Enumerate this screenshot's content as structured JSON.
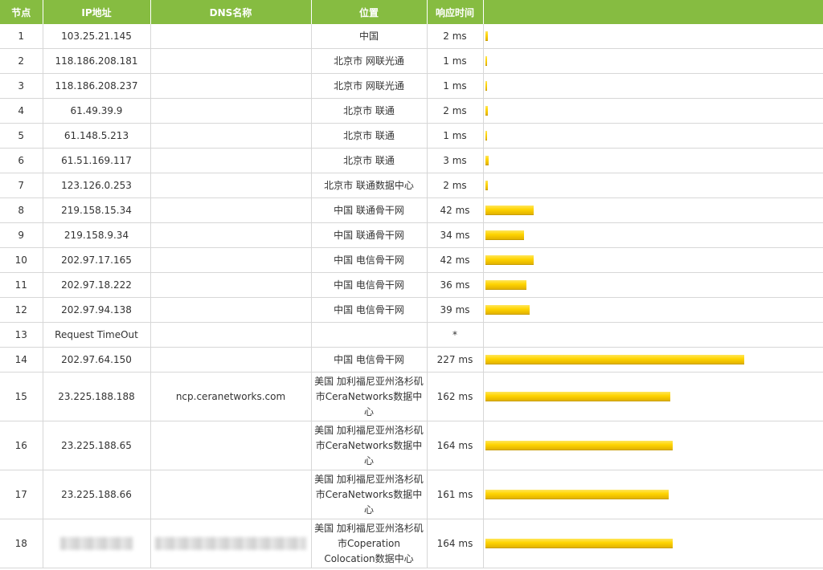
{
  "headers": [
    "节点",
    "IP地址",
    "DNS名称",
    "位置",
    "响应时间",
    ""
  ],
  "rows": [
    {
      "node": "1",
      "ip": "103.25.21.145",
      "dns": "",
      "loc": "中国",
      "time": "2 ms",
      "ms": 2
    },
    {
      "node": "2",
      "ip": "118.186.208.181",
      "dns": "",
      "loc": "北京市 网联光通",
      "time": "1 ms",
      "ms": 1
    },
    {
      "node": "3",
      "ip": "118.186.208.237",
      "dns": "",
      "loc": "北京市 网联光通",
      "time": "1 ms",
      "ms": 1
    },
    {
      "node": "4",
      "ip": "61.49.39.9",
      "dns": "",
      "loc": "北京市 联通",
      "time": "2 ms",
      "ms": 2
    },
    {
      "node": "5",
      "ip": "61.148.5.213",
      "dns": "",
      "loc": "北京市 联通",
      "time": "1 ms",
      "ms": 1
    },
    {
      "node": "6",
      "ip": "61.51.169.117",
      "dns": "",
      "loc": "北京市 联通",
      "time": "3 ms",
      "ms": 3
    },
    {
      "node": "7",
      "ip": "123.126.0.253",
      "dns": "",
      "loc": "北京市 联通数据中心",
      "time": "2 ms",
      "ms": 2
    },
    {
      "node": "8",
      "ip": "219.158.15.34",
      "dns": "",
      "loc": "中国 联通骨干网",
      "time": "42 ms",
      "ms": 42
    },
    {
      "node": "9",
      "ip": "219.158.9.34",
      "dns": "",
      "loc": "中国 联通骨干网",
      "time": "34 ms",
      "ms": 34
    },
    {
      "node": "10",
      "ip": "202.97.17.165",
      "dns": "",
      "loc": "中国 电信骨干网",
      "time": "42 ms",
      "ms": 42
    },
    {
      "node": "11",
      "ip": "202.97.18.222",
      "dns": "",
      "loc": "中国 电信骨干网",
      "time": "36 ms",
      "ms": 36
    },
    {
      "node": "12",
      "ip": "202.97.94.138",
      "dns": "",
      "loc": "中国 电信骨干网",
      "time": "39 ms",
      "ms": 39
    },
    {
      "node": "13",
      "ip": "Request TimeOut",
      "dns": "",
      "loc": "",
      "time": "*",
      "ms": 0
    },
    {
      "node": "14",
      "ip": "202.97.64.150",
      "dns": "",
      "loc": "中国 电信骨干网",
      "time": "227 ms",
      "ms": 227
    },
    {
      "node": "15",
      "ip": "23.225.188.188",
      "dns": "ncp.ceranetworks.com",
      "loc": "美国 加利福尼亚州洛杉矶市CeraNetworks数据中心",
      "time": "162 ms",
      "ms": 162,
      "tall": true
    },
    {
      "node": "16",
      "ip": "23.225.188.65",
      "dns": "",
      "loc": "美国 加利福尼亚州洛杉矶市CeraNetworks数据中心",
      "time": "164 ms",
      "ms": 164,
      "tall": true
    },
    {
      "node": "17",
      "ip": "23.225.188.66",
      "dns": "",
      "loc": "美国 加利福尼亚州洛杉矶市CeraNetworks数据中心",
      "time": "161 ms",
      "ms": 161,
      "tall": true
    },
    {
      "node": "18",
      "ip": "",
      "dns": "",
      "loc": "美国 加利福尼亚州洛杉矶市Coperation Colocation数据中心",
      "time": "164 ms",
      "ms": 164,
      "tall": true,
      "redacted": true
    }
  ],
  "colors": {
    "header_bg": "#86bc41",
    "bar": "#ffd400"
  }
}
